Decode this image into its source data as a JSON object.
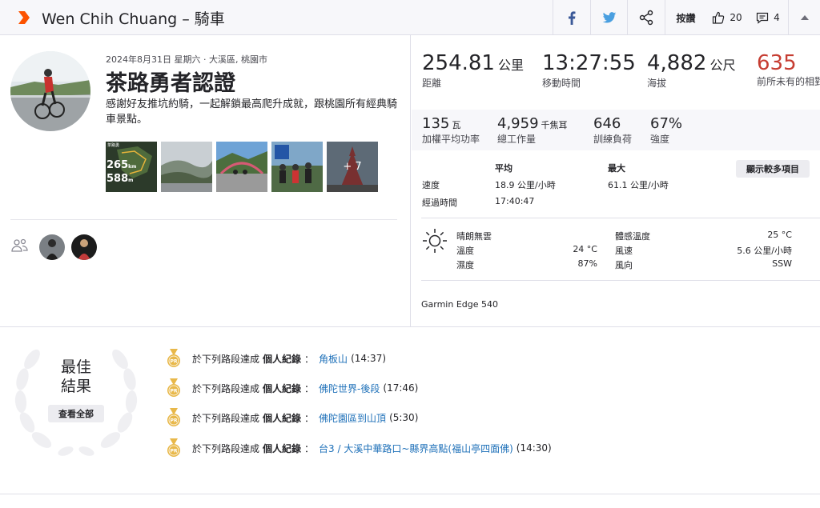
{
  "header": {
    "title": "Wen Chih Chuang – 騎車",
    "kudos_label": "按讚",
    "kudos_count": "20",
    "comments_count": "4",
    "icons": [
      "facebook-icon",
      "twitter-icon",
      "share-icon",
      "thumbs-up-icon",
      "comment-icon",
      "collapse-icon"
    ]
  },
  "activity": {
    "meta": "2024年8月31日 星期六 · 大溪區, 桃園市",
    "title": "茶路勇者認證",
    "description": "感謝好友推坑約騎，一起解鎖最高爬升成就，跟桃園所有經典騎車景點。",
    "photos_more": "+ 7",
    "map_photo": {
      "distance": "265",
      "distance_unit": "km",
      "elevation": "588",
      "elevation_unit": "m",
      "label": "茶路勇"
    }
  },
  "stats": {
    "distance": {
      "value": "254.81",
      "unit": "公里",
      "label": "距離"
    },
    "moving_time": {
      "value": "13:27:55",
      "unit": "",
      "label": "移動時間"
    },
    "elevation": {
      "value": "4,882",
      "unit": "公尺",
      "label": "海拔"
    },
    "relative_effort": {
      "value": "635",
      "label": "前所未有的相對耗力",
      "color": "#c63d32"
    },
    "weighted_power": {
      "value": "135",
      "unit": "瓦",
      "label": "加權平均功率"
    },
    "work": {
      "value": "4,959",
      "unit": "千焦耳",
      "label": "總工作量"
    },
    "training_load": {
      "value": "646",
      "unit": "",
      "label": "訓練負荷"
    },
    "intensity": {
      "value": "67%",
      "unit": "",
      "label": "強度"
    }
  },
  "details": {
    "col_avg": "平均",
    "col_max": "最大",
    "more_label": "顯示較多項目",
    "speed_label": "速度",
    "speed_avg": "18.9 公里/小時",
    "speed_max": "61.1 公里/小時",
    "elapsed_label": "經過時間",
    "elapsed_value": "17:40:47"
  },
  "weather": {
    "condition": "晴朗無雲",
    "temp_label": "溫度",
    "temp_value": "24 °C",
    "humidity_label": "濕度",
    "humidity_value": "87%",
    "feels_label": "體感溫度",
    "feels_value": "25 °C",
    "wind_speed_label": "風速",
    "wind_speed_value": "5.6 公里/小時",
    "wind_dir_label": "風向",
    "wind_dir_value": "SSW"
  },
  "device": "Garmin Edge 540",
  "best_results": {
    "title_line1": "最佳",
    "title_line2": "結果",
    "view_all": "查看全部",
    "medal_text": "PR",
    "prefix": "於下列路段達成",
    "record_label": "個人紀錄",
    "colon": "：",
    "items": [
      {
        "segment": "角板山",
        "time": "(14:37)"
      },
      {
        "segment": "佛陀世界-後段",
        "time": "(17:46)"
      },
      {
        "segment": "佛陀園區到山頂",
        "time": "(5:30)"
      },
      {
        "segment": "台3 / 大溪中華路口~縣界高點(福山亭四面佛)",
        "time": "(14:30)"
      }
    ]
  },
  "colors": {
    "brand": "#fc5200",
    "link": "#1c6fb8",
    "medal": "#e8b84a"
  }
}
